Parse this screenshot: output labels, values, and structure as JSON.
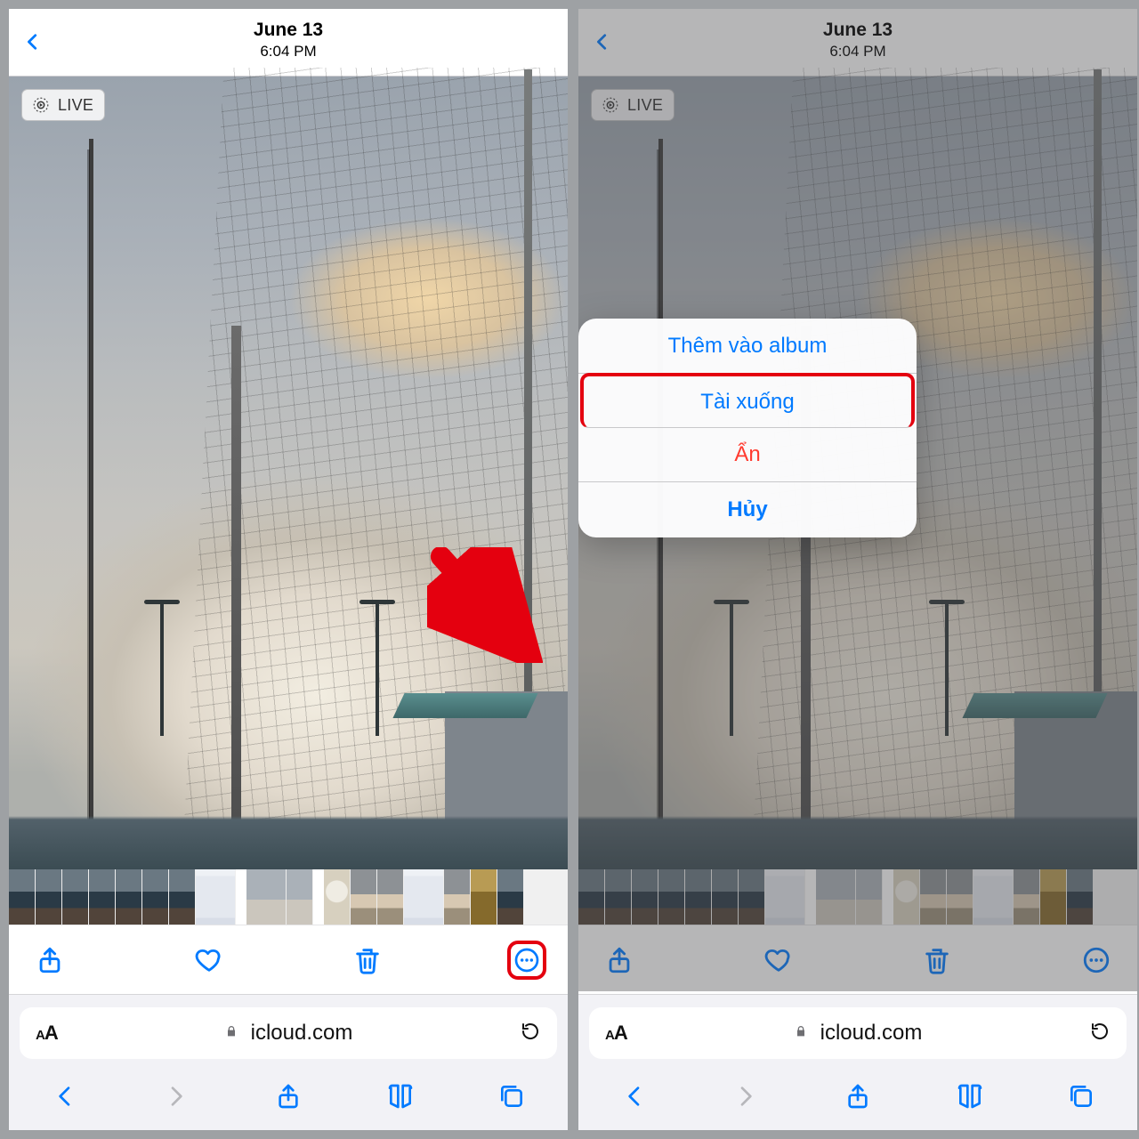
{
  "header": {
    "date": "June 13",
    "time": "6:04 PM"
  },
  "live_badge": "LIVE",
  "icons": {
    "back": "back-chevron-icon",
    "live": "live-photo-icon",
    "share": "share-icon",
    "heart": "heart-icon",
    "trash": "trash-icon",
    "more": "more-icon",
    "aa": "text-size-icon",
    "lock": "lock-icon",
    "reload": "reload-icon",
    "nav_back": "safari-back-icon",
    "nav_fwd": "safari-forward-icon",
    "nav_share": "safari-share-icon",
    "nav_book": "safari-bookmarks-icon",
    "nav_tabs": "safari-tabs-icon"
  },
  "url": {
    "host": "icloud.com",
    "aa_small": "A",
    "aa_big": "A"
  },
  "sheet": {
    "add_to_album": "Thêm vào album",
    "download": "Tài xuống",
    "hide": "Ẩn",
    "cancel": "Hủy"
  },
  "annotation": {
    "arrow_target": "more-button",
    "highlighted_option": "download"
  }
}
